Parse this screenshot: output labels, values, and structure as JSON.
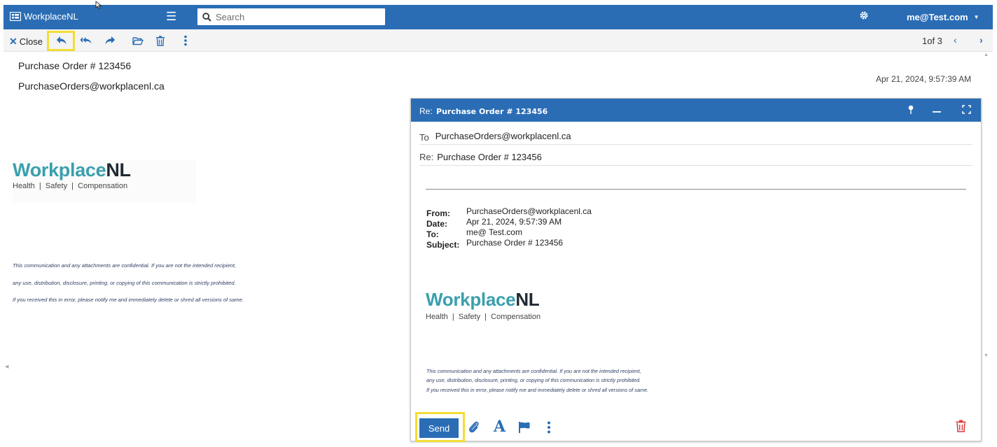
{
  "app": {
    "brand": "WorkplaceNL",
    "search_placeholder": "Search",
    "user": "me@Test.com"
  },
  "toolbar": {
    "close_label": "Close",
    "pager": "1of 3"
  },
  "message": {
    "subject": "Purchase Order # 123456",
    "from": "PurchaseOrders@workplacenl.ca",
    "date": "Apr 21, 2024, 9:57:39 AM",
    "logo_word_a": "Workplace",
    "logo_word_b": "NL",
    "logo_tagline": "Health  |  Safety  |  Compensation",
    "disclaimer": [
      "This communication and any attachments are confidential. If you are not the intended recipient,",
      "any use, distribution, disclosure, printing, or copying of this communication is strictly prohibited.",
      "If you received this in error, please notify me and immediately delete or shred all versions of same."
    ]
  },
  "compose": {
    "title_prefix": "Re:",
    "title": "Purchase Order # 123456",
    "to_label": "To",
    "to_value": "PurchaseOrders@workplacenl.ca",
    "re_label": "Re:",
    "re_value": "Purchase Order # 123456",
    "quote": {
      "from_label": "From:",
      "from_value": "PurchaseOrders@workplacenl.ca",
      "date_label": "Date:",
      "date_value": "Apr 21, 2024, 9:57:39 AM",
      "to_label": "To:",
      "to_value": "me@ Test.com",
      "subject_label": "Subject:",
      "subject_value": "Purchase Order # 123456"
    },
    "font_glyph": "A",
    "send_label": "Send"
  },
  "colors": {
    "brand_blue": "#2a6db5",
    "logo_teal": "#3aa0ad",
    "highlight": "#f2dd35",
    "delete_red": "#d93a3a"
  },
  "icons": {
    "toolbar": [
      "reply-icon",
      "reply-all-icon",
      "forward-icon",
      "folder-icon",
      "trash-icon",
      "more-vertical-icon"
    ],
    "compose_footer": [
      "paperclip-icon",
      "font-icon",
      "flag-icon",
      "more-vertical-icon",
      "trash-icon"
    ]
  }
}
